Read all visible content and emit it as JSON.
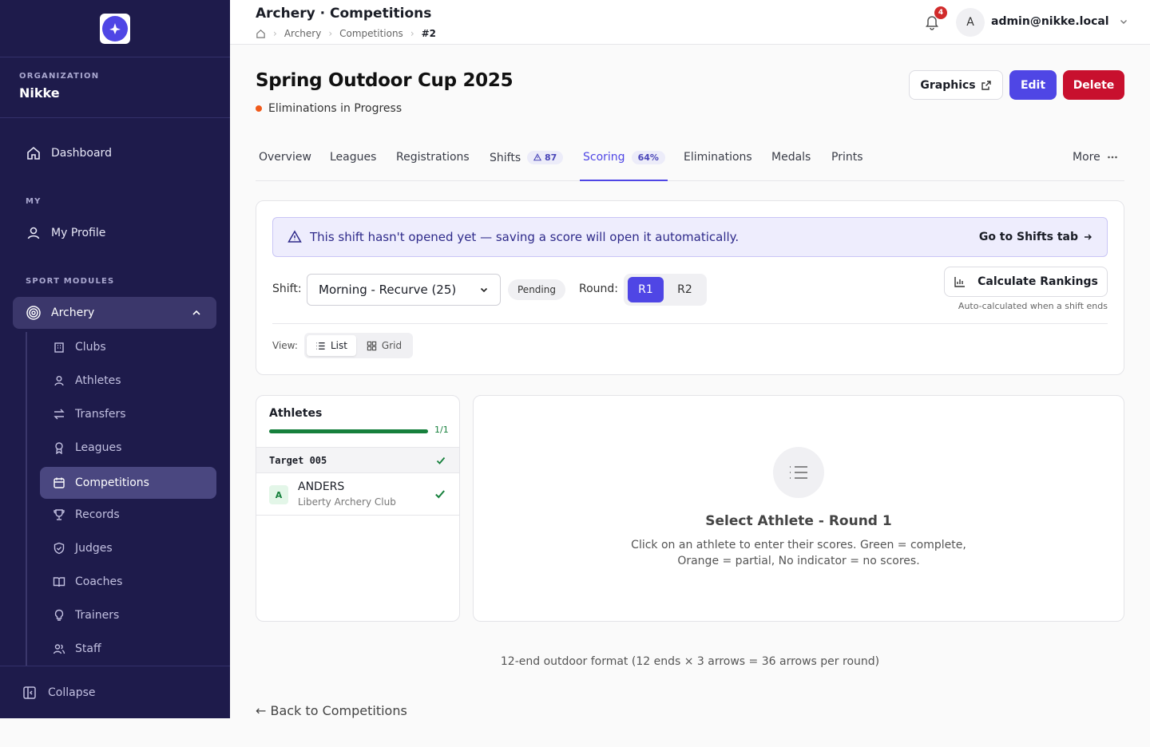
{
  "sidebar": {
    "org_label": "ORGANIZATION",
    "org_name": "Nikke",
    "dashboard": "Dashboard",
    "my_label": "MY",
    "my_profile": "My Profile",
    "sport_modules_label": "SPORT MODULES",
    "archery": "Archery",
    "items": [
      "Clubs",
      "Athletes",
      "Transfers",
      "Leagues",
      "Competitions",
      "Records",
      "Judges",
      "Coaches",
      "Trainers",
      "Staff"
    ],
    "active_item": "Competitions",
    "collapse": "Collapse"
  },
  "topbar": {
    "title": "Archery · Competitions",
    "breadcrumb": [
      "Archery",
      "Competitions",
      "#2"
    ],
    "notification_count": "4",
    "avatar_initial": "A",
    "user_email": "admin@nikke.local"
  },
  "page": {
    "title": "Spring Outdoor Cup 2025",
    "status": "Eliminations in Progress",
    "graphics_label": "Graphics",
    "edit_label": "Edit",
    "delete_label": "Delete"
  },
  "tabs": {
    "overview": "Overview",
    "leagues": "Leagues",
    "registrations": "Registrations",
    "shifts": "Shifts",
    "shifts_badge": "87",
    "scoring": "Scoring",
    "scoring_badge": "64%",
    "eliminations": "Eliminations",
    "medals": "Medals",
    "prints": "Prints",
    "more": "More"
  },
  "scoring": {
    "banner_text": "This shift hasn't opened yet — saving a score will open it automatically.",
    "banner_link": "Go to Shifts tab",
    "shift_label": "Shift:",
    "shift_value": "Morning - Recurve (25)",
    "shift_status": "Pending",
    "round_label": "Round:",
    "round_options": [
      "R1",
      "R2"
    ],
    "selected_round": "R1",
    "calc_button": "Calculate Rankings",
    "calc_hint": "Auto-calculated when a shift ends",
    "view_label": "View:",
    "view_list": "List",
    "view_grid": "Grid",
    "selected_view": "List"
  },
  "athletes": {
    "title": "Athletes",
    "progress_text": "1/1",
    "progress_fraction": 1.0,
    "target": "Target 005",
    "athlete_initial": "A",
    "athlete_name": "ANDERS",
    "athlete_club": "Liberty Archery Club"
  },
  "detail": {
    "title": "Select Athlete - Round 1",
    "line1": "Click on an athlete to enter their scores. Green = complete,",
    "line2": "Orange = partial, No indicator = no scores."
  },
  "footer": {
    "format_note": "12-end outdoor format (12 ends × 3 arrows = 36 arrows per round)",
    "back_link": "← Back to Competitions"
  },
  "colors": {
    "sidebar_bg": "#1e1b4b",
    "accent": "#4f46e5",
    "danger": "#c8102e",
    "success": "#16803c",
    "status_dot": "#f05a1b"
  }
}
